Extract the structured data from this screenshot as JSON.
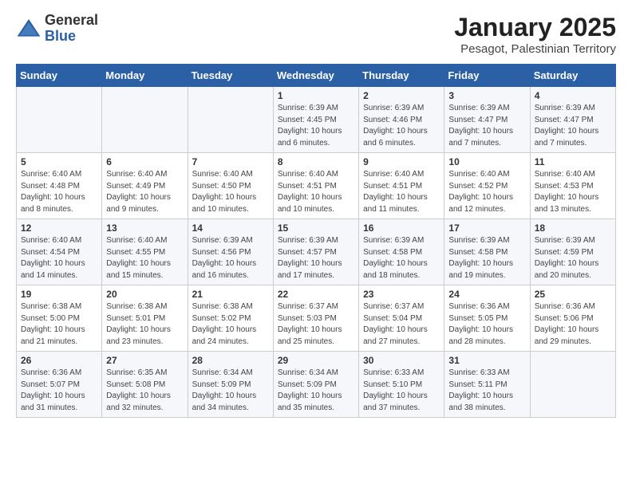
{
  "logo": {
    "general": "General",
    "blue": "Blue"
  },
  "title": "January 2025",
  "subtitle": "Pesagot, Palestinian Territory",
  "weekdays": [
    "Sunday",
    "Monday",
    "Tuesday",
    "Wednesday",
    "Thursday",
    "Friday",
    "Saturday"
  ],
  "weeks": [
    [
      null,
      null,
      null,
      {
        "day": "1",
        "sunrise": "6:39 AM",
        "sunset": "4:45 PM",
        "daylight": "10 hours and 6 minutes."
      },
      {
        "day": "2",
        "sunrise": "6:39 AM",
        "sunset": "4:46 PM",
        "daylight": "10 hours and 6 minutes."
      },
      {
        "day": "3",
        "sunrise": "6:39 AM",
        "sunset": "4:47 PM",
        "daylight": "10 hours and 7 minutes."
      },
      {
        "day": "4",
        "sunrise": "6:39 AM",
        "sunset": "4:47 PM",
        "daylight": "10 hours and 7 minutes."
      }
    ],
    [
      {
        "day": "5",
        "sunrise": "6:40 AM",
        "sunset": "4:48 PM",
        "daylight": "10 hours and 8 minutes."
      },
      {
        "day": "6",
        "sunrise": "6:40 AM",
        "sunset": "4:49 PM",
        "daylight": "10 hours and 9 minutes."
      },
      {
        "day": "7",
        "sunrise": "6:40 AM",
        "sunset": "4:50 PM",
        "daylight": "10 hours and 10 minutes."
      },
      {
        "day": "8",
        "sunrise": "6:40 AM",
        "sunset": "4:51 PM",
        "daylight": "10 hours and 10 minutes."
      },
      {
        "day": "9",
        "sunrise": "6:40 AM",
        "sunset": "4:51 PM",
        "daylight": "10 hours and 11 minutes."
      },
      {
        "day": "10",
        "sunrise": "6:40 AM",
        "sunset": "4:52 PM",
        "daylight": "10 hours and 12 minutes."
      },
      {
        "day": "11",
        "sunrise": "6:40 AM",
        "sunset": "4:53 PM",
        "daylight": "10 hours and 13 minutes."
      }
    ],
    [
      {
        "day": "12",
        "sunrise": "6:40 AM",
        "sunset": "4:54 PM",
        "daylight": "10 hours and 14 minutes."
      },
      {
        "day": "13",
        "sunrise": "6:40 AM",
        "sunset": "4:55 PM",
        "daylight": "10 hours and 15 minutes."
      },
      {
        "day": "14",
        "sunrise": "6:39 AM",
        "sunset": "4:56 PM",
        "daylight": "10 hours and 16 minutes."
      },
      {
        "day": "15",
        "sunrise": "6:39 AM",
        "sunset": "4:57 PM",
        "daylight": "10 hours and 17 minutes."
      },
      {
        "day": "16",
        "sunrise": "6:39 AM",
        "sunset": "4:58 PM",
        "daylight": "10 hours and 18 minutes."
      },
      {
        "day": "17",
        "sunrise": "6:39 AM",
        "sunset": "4:58 PM",
        "daylight": "10 hours and 19 minutes."
      },
      {
        "day": "18",
        "sunrise": "6:39 AM",
        "sunset": "4:59 PM",
        "daylight": "10 hours and 20 minutes."
      }
    ],
    [
      {
        "day": "19",
        "sunrise": "6:38 AM",
        "sunset": "5:00 PM",
        "daylight": "10 hours and 21 minutes."
      },
      {
        "day": "20",
        "sunrise": "6:38 AM",
        "sunset": "5:01 PM",
        "daylight": "10 hours and 23 minutes."
      },
      {
        "day": "21",
        "sunrise": "6:38 AM",
        "sunset": "5:02 PM",
        "daylight": "10 hours and 24 minutes."
      },
      {
        "day": "22",
        "sunrise": "6:37 AM",
        "sunset": "5:03 PM",
        "daylight": "10 hours and 25 minutes."
      },
      {
        "day": "23",
        "sunrise": "6:37 AM",
        "sunset": "5:04 PM",
        "daylight": "10 hours and 27 minutes."
      },
      {
        "day": "24",
        "sunrise": "6:36 AM",
        "sunset": "5:05 PM",
        "daylight": "10 hours and 28 minutes."
      },
      {
        "day": "25",
        "sunrise": "6:36 AM",
        "sunset": "5:06 PM",
        "daylight": "10 hours and 29 minutes."
      }
    ],
    [
      {
        "day": "26",
        "sunrise": "6:36 AM",
        "sunset": "5:07 PM",
        "daylight": "10 hours and 31 minutes."
      },
      {
        "day": "27",
        "sunrise": "6:35 AM",
        "sunset": "5:08 PM",
        "daylight": "10 hours and 32 minutes."
      },
      {
        "day": "28",
        "sunrise": "6:34 AM",
        "sunset": "5:09 PM",
        "daylight": "10 hours and 34 minutes."
      },
      {
        "day": "29",
        "sunrise": "6:34 AM",
        "sunset": "5:09 PM",
        "daylight": "10 hours and 35 minutes."
      },
      {
        "day": "30",
        "sunrise": "6:33 AM",
        "sunset": "5:10 PM",
        "daylight": "10 hours and 37 minutes."
      },
      {
        "day": "31",
        "sunrise": "6:33 AM",
        "sunset": "5:11 PM",
        "daylight": "10 hours and 38 minutes."
      },
      null
    ]
  ],
  "labels": {
    "sunrise_prefix": "Sunrise: ",
    "sunset_prefix": "Sunset: ",
    "daylight_prefix": "Daylight: "
  }
}
